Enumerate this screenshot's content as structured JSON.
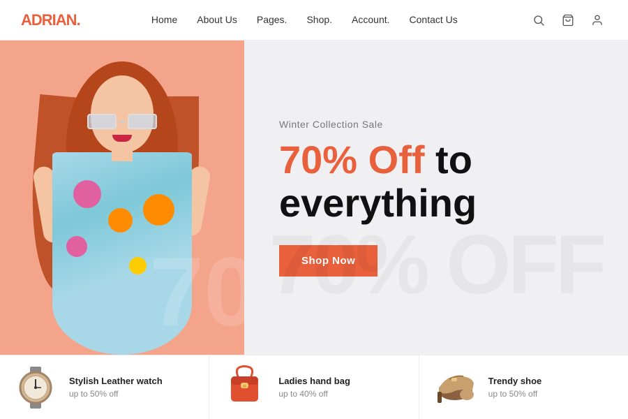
{
  "brand": {
    "name": "ADRIAN",
    "dot": "."
  },
  "nav": {
    "links": [
      {
        "label": "Home",
        "id": "home"
      },
      {
        "label": "About Us",
        "id": "about"
      },
      {
        "label": "Pages.",
        "id": "pages"
      },
      {
        "label": "Shop.",
        "id": "shop"
      },
      {
        "label": "Account.",
        "id": "account"
      },
      {
        "label": "Contact Us",
        "id": "contact"
      }
    ]
  },
  "hero": {
    "subtitle": "Winter Collection Sale",
    "title_accent": "70% Off",
    "title_rest": " to everything",
    "cta_label": "Shop Now",
    "watermark": "70"
  },
  "products": [
    {
      "name": "Stylish Leather watch",
      "discount": "up to 50% off",
      "color": "#c8a882"
    },
    {
      "name": "Ladies hand bag",
      "discount": "up to 40% off",
      "color": "#e05030"
    },
    {
      "name": "Trendy shoe",
      "discount": "up to 50% off",
      "color": "#c8a070"
    }
  ],
  "colors": {
    "accent": "#e8603c",
    "hero_bg_left": "#f4a48a",
    "hero_bg_right": "#f0f0f2"
  }
}
